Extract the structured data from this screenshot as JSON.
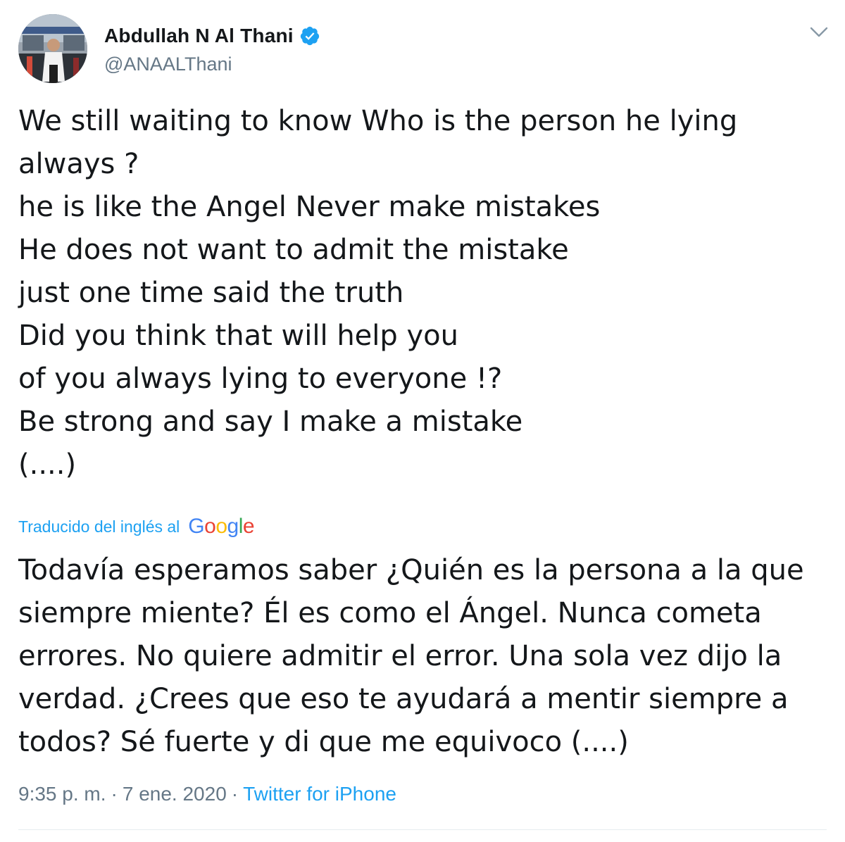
{
  "author": {
    "display_name": "Abdullah N Al Thani",
    "handle": "@ANAALThani",
    "verified": true,
    "avatar_icon": "profile-photo"
  },
  "menu": {
    "icon": "chevron-down-icon"
  },
  "tweet": {
    "lines": [
      "We still waiting to know Who is the person he lying",
      "always ?",
      "he is like the Angel Never make mistakes",
      "He does not want to admit the mistake",
      "just one time said the truth",
      "Did you think that will help you",
      "of you always lying to everyone !?",
      "Be strong and say I make a mistake",
      "(....)"
    ]
  },
  "translation": {
    "label": "Traducido del inglés al",
    "provider": "Google",
    "lines": [
      "Todavía esperamos saber ¿Quién es la persona a la que",
      "siempre miente? Él es como el Ángel. Nunca cometa",
      "errores. No quiere admitir el error. Una sola vez dijo la",
      "verdad. ¿Crees que eso te ayudará a mentir siempre a",
      "todos? Sé fuerte y di que me equivoco (....)"
    ]
  },
  "meta": {
    "time": "9:35 p. m.",
    "separator": "·",
    "date": "7 ene. 2020",
    "source": "Twitter for iPhone"
  },
  "colors": {
    "link": "#1da1f2",
    "secondary_text": "#657786",
    "primary_text": "#14171a",
    "verified_badge": "#1da1f2"
  }
}
